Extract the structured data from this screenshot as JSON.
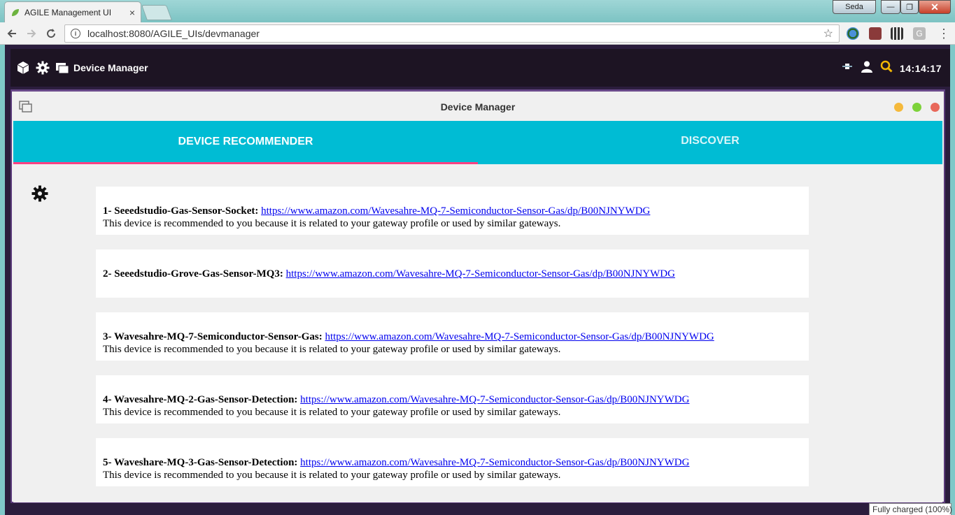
{
  "browser": {
    "tab_title": "AGILE Management UI",
    "tab_close": "×",
    "url": "localhost:8080/AGILE_UIs/devmanager",
    "user_name": "Seda",
    "close_glyph": "✕",
    "minimize_glyph": "—",
    "maximize_glyph": "❐"
  },
  "app": {
    "title": "Device Manager",
    "clock": "14:14:17"
  },
  "window": {
    "title": "Device Manager",
    "dot_colors": [
      "#f5b93b",
      "#7dd23a",
      "#e8685a"
    ]
  },
  "tabs": [
    {
      "label": "DEVICE RECOMMENDER",
      "active": true
    },
    {
      "label": "DISCOVER",
      "active": false
    }
  ],
  "recommendations": [
    {
      "name": "1- Seeedstudio-Gas-Sensor-Socket:",
      "link": "https://www.amazon.com/Wavesahre-MQ-7-Semiconductor-Sensor-Gas/dp/B00NJNYWDG",
      "reason": "This device is recommended to you because it is related to your gateway profile or used by similar gateways."
    },
    {
      "name": "2- Seeedstudio-Grove-Gas-Sensor-MQ3:",
      "link": "https://www.amazon.com/Wavesahre-MQ-7-Semiconductor-Sensor-Gas/dp/B00NJNYWDG",
      "reason": ""
    },
    {
      "name": "3- Wavesahre-MQ-7-Semiconductor-Sensor-Gas:",
      "link": "https://www.amazon.com/Wavesahre-MQ-7-Semiconductor-Sensor-Gas/dp/B00NJNYWDG",
      "reason": "This device is recommended to you because it is related to your gateway profile or used by similar gateways."
    },
    {
      "name": "4- Wavesahre-MQ-2-Gas-Sensor-Detection:",
      "link": "https://www.amazon.com/Wavesahre-MQ-7-Semiconductor-Sensor-Gas/dp/B00NJNYWDG",
      "reason": "This device is recommended to you because it is related to your gateway profile or used by similar gateways."
    },
    {
      "name": "5- Waveshare-MQ-3-Gas-Sensor-Detection:",
      "link": "https://www.amazon.com/Wavesahre-MQ-7-Semiconductor-Sensor-Gas/dp/B00NJNYWDG",
      "reason": "This device is recommended to you because it is related to your gateway profile or used by similar gateways."
    }
  ],
  "tooltip": "Fully charged (100%)",
  "icons": {
    "tab_favicon": "leaf-icon",
    "back": "back-arrow-icon",
    "forward": "forward-arrow-icon",
    "reload": "reload-icon",
    "info": "info-icon",
    "bookmark": "star-icon",
    "app_cube": "cube-icon",
    "app_gear": "gear-icon",
    "app_devices": "devices-icon",
    "wifi": "network-icon",
    "user": "user-icon",
    "search": "search-icon",
    "settings": "settings-icon"
  }
}
